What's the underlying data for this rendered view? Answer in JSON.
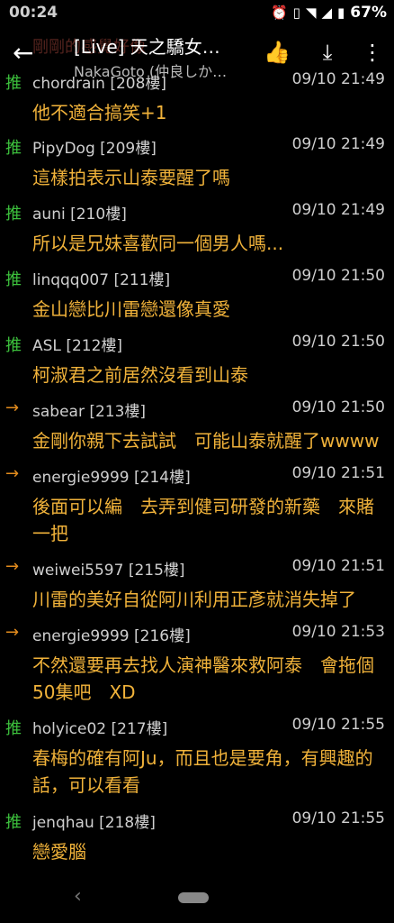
{
  "status": {
    "time": "00:24",
    "battery": "67%"
  },
  "header": {
    "ghost_title": "剛剛的感覺好像",
    "title": "[Live] 天之驕女…",
    "subtitle": "NakaGoto (仲良しか…"
  },
  "comments": [
    {
      "tag": "推",
      "user": "chordrain",
      "floor": "[208樓]",
      "time": "09/10 21:49",
      "content": "他不適合搞笑+1"
    },
    {
      "tag": "推",
      "user": "PipyDog",
      "floor": "[209樓]",
      "time": "09/10 21:49",
      "content": "這樣拍表示山泰要醒了嗎"
    },
    {
      "tag": "推",
      "user": "auni",
      "floor": "[210樓]",
      "time": "09/10 21:49",
      "content": "所以是兄妹喜歡同一個男人嗎..."
    },
    {
      "tag": "推",
      "user": "linqqq007",
      "floor": "[211樓]",
      "time": "09/10 21:50",
      "content": "金山戀比川雷戀還像真愛"
    },
    {
      "tag": "推",
      "user": "ASL",
      "floor": "[212樓]",
      "time": "09/10 21:50",
      "content": "柯淑君之前居然沒看到山泰"
    },
    {
      "tag": "→",
      "user": "sabear",
      "floor": "[213樓]",
      "time": "09/10 21:50",
      "content": "金剛你親下去試試　可能山泰就醒了wwww"
    },
    {
      "tag": "→",
      "user": "energie9999",
      "floor": "[214樓]",
      "time": "09/10 21:51",
      "content": "後面可以編　去弄到健司研發的新藥　來賭一把"
    },
    {
      "tag": "→",
      "user": "weiwei5597",
      "floor": "[215樓]",
      "time": "09/10 21:51",
      "content": "川雷的美好自從阿川利用正彥就消失掉了"
    },
    {
      "tag": "→",
      "user": "energie9999",
      "floor": "[216樓]",
      "time": "09/10 21:53",
      "content": "不然還要再去找人演神醫來救阿泰　會拖個50集吧　XD"
    },
    {
      "tag": "推",
      "user": "holyice02",
      "floor": "[217樓]",
      "time": "09/10 21:55",
      "content": "春梅的確有阿Ju，而且也是要角，有興趣的話，可以看看"
    },
    {
      "tag": "推",
      "user": "jenqhau",
      "floor": "[218樓]",
      "time": "09/10 21:55",
      "content": "戀愛腦"
    }
  ],
  "colors": {
    "push": "#3cbf3c",
    "arrow": "#e28b1d",
    "content": "#f0b23a"
  },
  "icons": [
    "back-arrow-icon",
    "thumbs-up-down-icon",
    "download-icon",
    "more-vert-icon"
  ]
}
